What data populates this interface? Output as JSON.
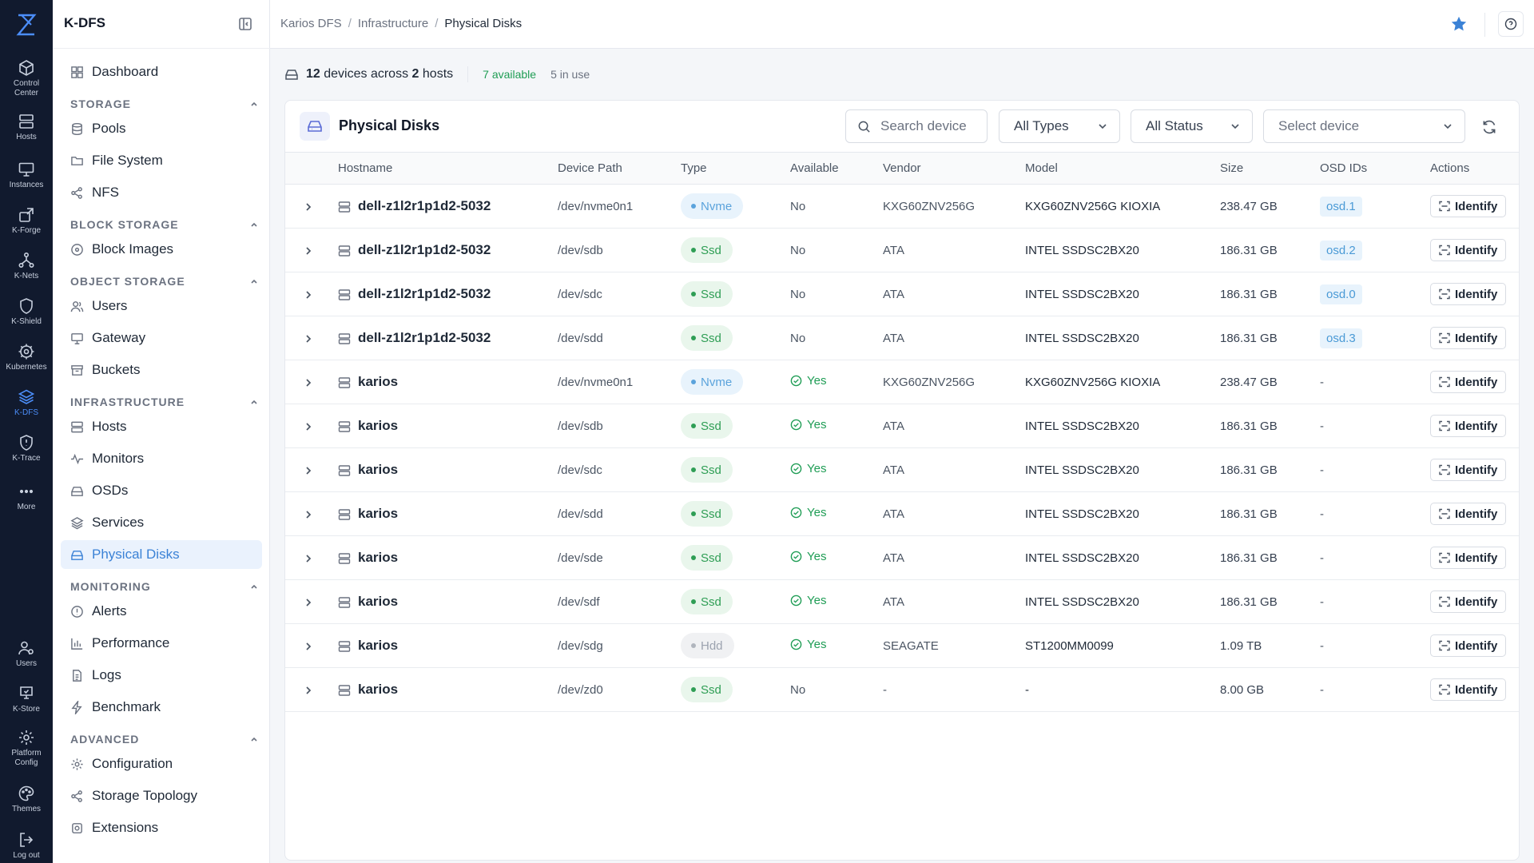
{
  "rail": {
    "items": [
      {
        "label": "Control\nCenter",
        "icon": "cube-icon"
      },
      {
        "label": "Hosts",
        "icon": "server-icon"
      },
      {
        "label": "Instances",
        "icon": "monitor-icon"
      },
      {
        "label": "K-Forge",
        "icon": "forge-icon"
      },
      {
        "label": "K-Nets",
        "icon": "network-icon"
      },
      {
        "label": "K-Shield",
        "icon": "shield-icon"
      },
      {
        "label": "Kubernetes",
        "icon": "helm-icon"
      },
      {
        "label": "K-DFS",
        "icon": "layers-icon"
      },
      {
        "label": "K-Trace",
        "icon": "trace-icon"
      },
      {
        "label": "More",
        "icon": "dots-icon"
      },
      {
        "label": "Users",
        "icon": "users-icon"
      },
      {
        "label": "K-Store",
        "icon": "store-icon"
      },
      {
        "label": "Platform\nConfig",
        "icon": "gear-icon"
      },
      {
        "label": "Themes",
        "icon": "palette-icon"
      },
      {
        "label": "Log out",
        "icon": "logout-icon"
      }
    ]
  },
  "sidebar": {
    "brand": "K-DFS",
    "dashboard": "Dashboard",
    "sections": {
      "storage": "STORAGE",
      "block_storage": "BLOCK STORAGE",
      "object_storage": "OBJECT STORAGE",
      "infrastructure": "INFRASTRUCTURE",
      "monitoring": "MONITORING",
      "advanced": "ADVANCED"
    },
    "items": {
      "pools": "Pools",
      "file_system": "File System",
      "nfs": "NFS",
      "block_images": "Block Images",
      "users": "Users",
      "gateway": "Gateway",
      "buckets": "Buckets",
      "hosts": "Hosts",
      "monitors": "Monitors",
      "osds": "OSDs",
      "services": "Services",
      "physical_disks": "Physical Disks",
      "alerts": "Alerts",
      "performance": "Performance",
      "logs": "Logs",
      "benchmark": "Benchmark",
      "configuration": "Configuration",
      "storage_topology": "Storage Topology",
      "extensions": "Extensions"
    }
  },
  "breadcrumb": [
    "Karios DFS",
    "Infrastructure",
    "Physical Disks"
  ],
  "summary": {
    "count": "12",
    "devices_across": "devices across",
    "hosts_count": "2",
    "hosts_word": "hosts",
    "available": "7 available",
    "in_use": "5 in use"
  },
  "panel": {
    "title": "Physical Disks",
    "search_placeholder": "Search device",
    "type_filter": "All Types",
    "status_filter": "All Status",
    "device_select": "Select device"
  },
  "table": {
    "columns": [
      "Hostname",
      "Device Path",
      "Type",
      "Available",
      "Vendor",
      "Model",
      "Size",
      "OSD IDs",
      "Actions"
    ],
    "action_label": "Identify",
    "rows": [
      {
        "host": "dell-z1l2r1p1d2-5032",
        "path": "/dev/nvme0n1",
        "type": "Nvme",
        "available": "No",
        "vendor": "KXG60ZNV256G",
        "model": "KXG60ZNV256G KIOXIA",
        "size": "238.47 GB",
        "osd": "osd.1"
      },
      {
        "host": "dell-z1l2r1p1d2-5032",
        "path": "/dev/sdb",
        "type": "Ssd",
        "available": "No",
        "vendor": "ATA",
        "model": "INTEL SSDSC2BX20",
        "size": "186.31 GB",
        "osd": "osd.2"
      },
      {
        "host": "dell-z1l2r1p1d2-5032",
        "path": "/dev/sdc",
        "type": "Ssd",
        "available": "No",
        "vendor": "ATA",
        "model": "INTEL SSDSC2BX20",
        "size": "186.31 GB",
        "osd": "osd.0"
      },
      {
        "host": "dell-z1l2r1p1d2-5032",
        "path": "/dev/sdd",
        "type": "Ssd",
        "available": "No",
        "vendor": "ATA",
        "model": "INTEL SSDSC2BX20",
        "size": "186.31 GB",
        "osd": "osd.3"
      },
      {
        "host": "karios",
        "path": "/dev/nvme0n1",
        "type": "Nvme",
        "available": "Yes",
        "vendor": "KXG60ZNV256G",
        "model": "KXG60ZNV256G KIOXIA",
        "size": "238.47 GB",
        "osd": "-"
      },
      {
        "host": "karios",
        "path": "/dev/sdb",
        "type": "Ssd",
        "available": "Yes",
        "vendor": "ATA",
        "model": "INTEL SSDSC2BX20",
        "size": "186.31 GB",
        "osd": "-"
      },
      {
        "host": "karios",
        "path": "/dev/sdc",
        "type": "Ssd",
        "available": "Yes",
        "vendor": "ATA",
        "model": "INTEL SSDSC2BX20",
        "size": "186.31 GB",
        "osd": "-"
      },
      {
        "host": "karios",
        "path": "/dev/sdd",
        "type": "Ssd",
        "available": "Yes",
        "vendor": "ATA",
        "model": "INTEL SSDSC2BX20",
        "size": "186.31 GB",
        "osd": "-"
      },
      {
        "host": "karios",
        "path": "/dev/sde",
        "type": "Ssd",
        "available": "Yes",
        "vendor": "ATA",
        "model": "INTEL SSDSC2BX20",
        "size": "186.31 GB",
        "osd": "-"
      },
      {
        "host": "karios",
        "path": "/dev/sdf",
        "type": "Ssd",
        "available": "Yes",
        "vendor": "ATA",
        "model": "INTEL SSDSC2BX20",
        "size": "186.31 GB",
        "osd": "-"
      },
      {
        "host": "karios",
        "path": "/dev/sdg",
        "type": "Hdd",
        "available": "Yes",
        "vendor": "SEAGATE",
        "model": "ST1200MM0099",
        "size": "1.09 TB",
        "osd": "-"
      },
      {
        "host": "karios",
        "path": "/dev/zd0",
        "type": "Ssd",
        "available": "No",
        "vendor": "-",
        "model": "-",
        "size": "8.00 GB",
        "osd": "-"
      }
    ]
  },
  "colors": {
    "rail_bg": "#111a2e",
    "accent": "#3b82d6",
    "available_green": "#1f9d55",
    "nvme_blue": "#5ba3dc"
  }
}
